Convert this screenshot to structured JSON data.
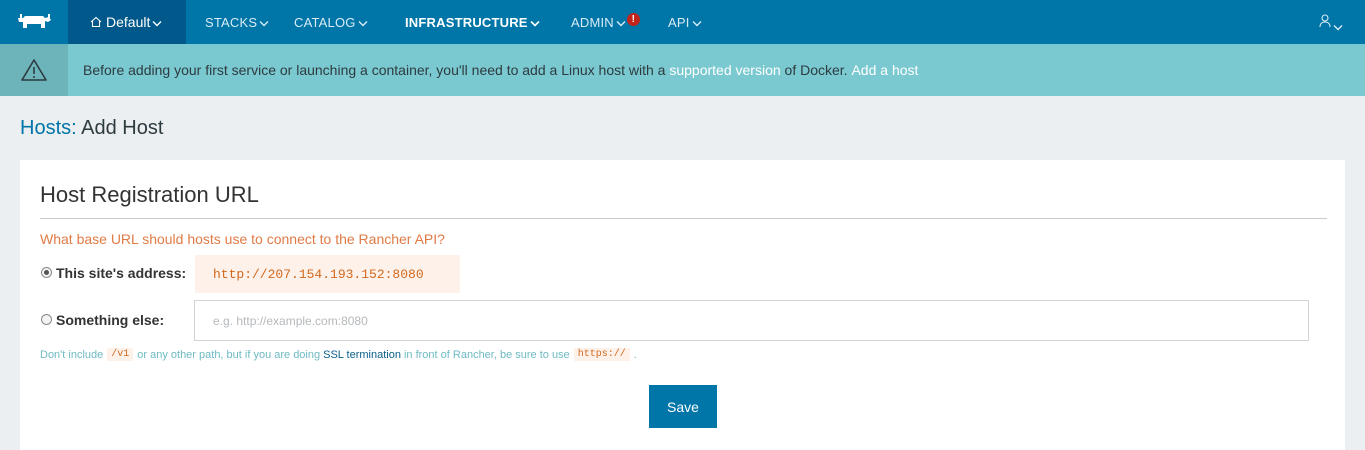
{
  "nav": {
    "environment": "Default",
    "items": [
      "STACKS",
      "CATALOG",
      "INFRASTRUCTURE",
      "ADMIN",
      "API"
    ],
    "admin_alert": "!",
    "accent": "#0075a8"
  },
  "banner": {
    "icon": "warning-icon",
    "text_before": "Before adding your first service or launching a container, you'll need to add a Linux host with a ",
    "link_supported": "supported version",
    "text_middle": " of Docker. ",
    "link_add_host": "Add a host"
  },
  "page": {
    "breadcrumb": "Hosts:",
    "title": "Add Host"
  },
  "panel": {
    "title": "Host Registration URL",
    "question": "What base URL should hosts use to connect to the Rancher API?",
    "option_site_label": "This site's address:",
    "site_address": "http://207.154.193.152:8080",
    "option_other_label": "Something else:",
    "other_placeholder": "e.g. http://example.com:8080",
    "hint_part1": "Don't include",
    "hint_code1": "/v1",
    "hint_part2": "or any other path, but if you are doing",
    "hint_ssl": "SSL termination",
    "hint_part3": "in front of Rancher, be sure to use",
    "hint_code2": "https://",
    "hint_end": ".",
    "save_label": "Save"
  }
}
